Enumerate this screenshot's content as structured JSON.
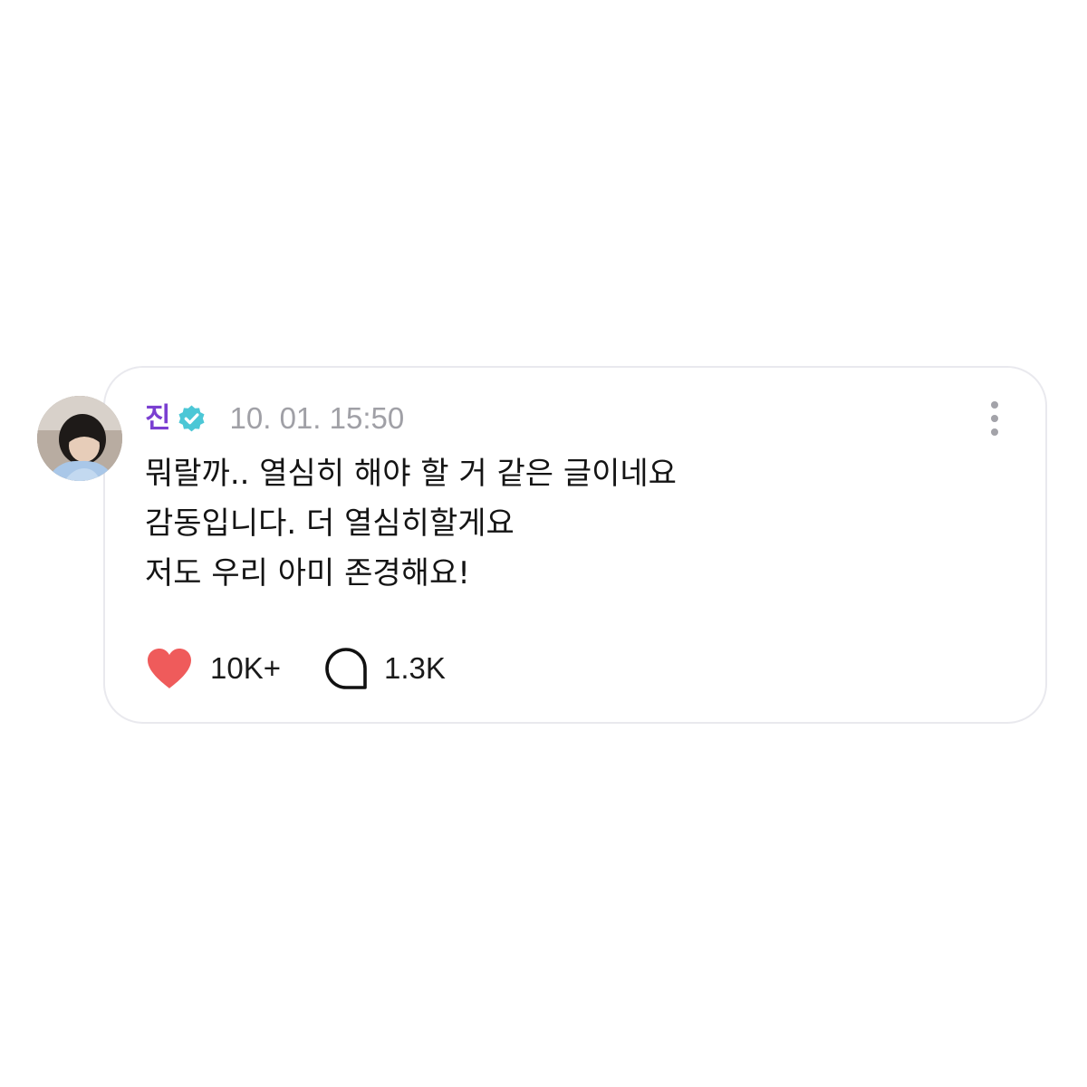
{
  "post": {
    "author": "진",
    "verified": true,
    "timestamp": "10. 01. 15:50",
    "lines": [
      "뭐랄까.. 열심히 해야 할 거 같은 글이네요",
      "감동입니다. 더 열심히할게요",
      "저도 우리 아미 존경해요!"
    ]
  },
  "actions": {
    "like_count": "10K+",
    "comment_count": "1.3K"
  },
  "icons": {
    "avatar": "profile-photo",
    "verified": "verified-badge-icon",
    "more": "more-vertical-icon",
    "like": "heart-icon",
    "comment": "comment-bubble-icon"
  },
  "colors": {
    "author": "#7a3fd1",
    "verified": "#4cc7d6",
    "timestamp": "#a0a0a6",
    "heart": "#ef5b5b",
    "card_border": "#e9e9ee"
  }
}
